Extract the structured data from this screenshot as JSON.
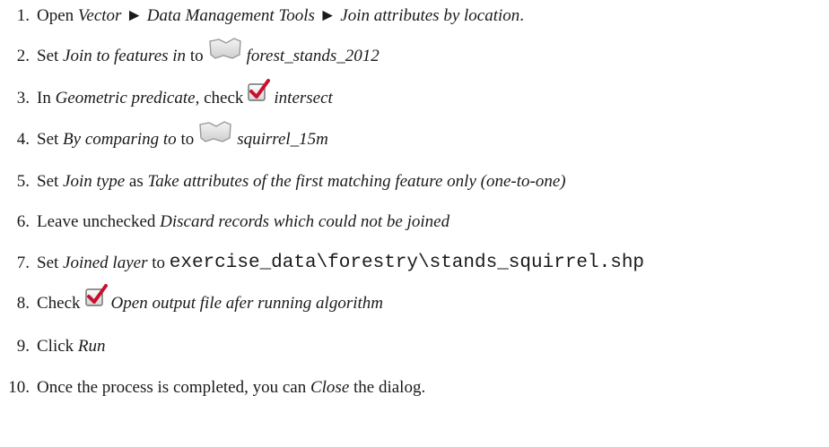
{
  "steps": [
    {
      "n": "1.",
      "p1": "Open ",
      "i1": "Vector",
      "sep1": " ► ",
      "i2": "Data Management Tools",
      "sep2": " ► ",
      "i3": "Join attributes by location",
      "p2": "."
    },
    {
      "n": "2.",
      "p1": "Set ",
      "i1": "Join to features in",
      "p2": " to",
      "i2": "forest_stands_2012",
      "icon": "polygon-layer-icon"
    },
    {
      "n": "3.",
      "p1": "In ",
      "i1": "Geometric predicate",
      "p2": ", check",
      "i2": "intersect",
      "icon": "checkbox-checked-icon"
    },
    {
      "n": "4.",
      "p1": "Set ",
      "i1": "By comparing to",
      "p2": " to",
      "i2": "squirrel_15m",
      "icon": "polygon-layer-icon"
    },
    {
      "n": "5.",
      "p1": "Set ",
      "i1": "Join type",
      "p2": " as ",
      "i2": "Take attributes of the first matching feature only (one-to-one)"
    },
    {
      "n": "6.",
      "p1": "Leave unchecked ",
      "i1": "Discard records which could not be joined"
    },
    {
      "n": "7.",
      "p1": "Set ",
      "i1": "Joined layer",
      "p2": " to ",
      "code": "exercise_data\\forestry\\stands_squirrel.shp"
    },
    {
      "n": "8.",
      "p1": "Check",
      "i1": "Open output file afer running algorithm",
      "icon": "checkbox-checked-icon"
    },
    {
      "n": "9.",
      "p1": "Click ",
      "i1": "Run"
    },
    {
      "n": "10.",
      "p1": "Once the process is completed, you can ",
      "i1": "Close",
      "p2": " the dialog."
    }
  ]
}
